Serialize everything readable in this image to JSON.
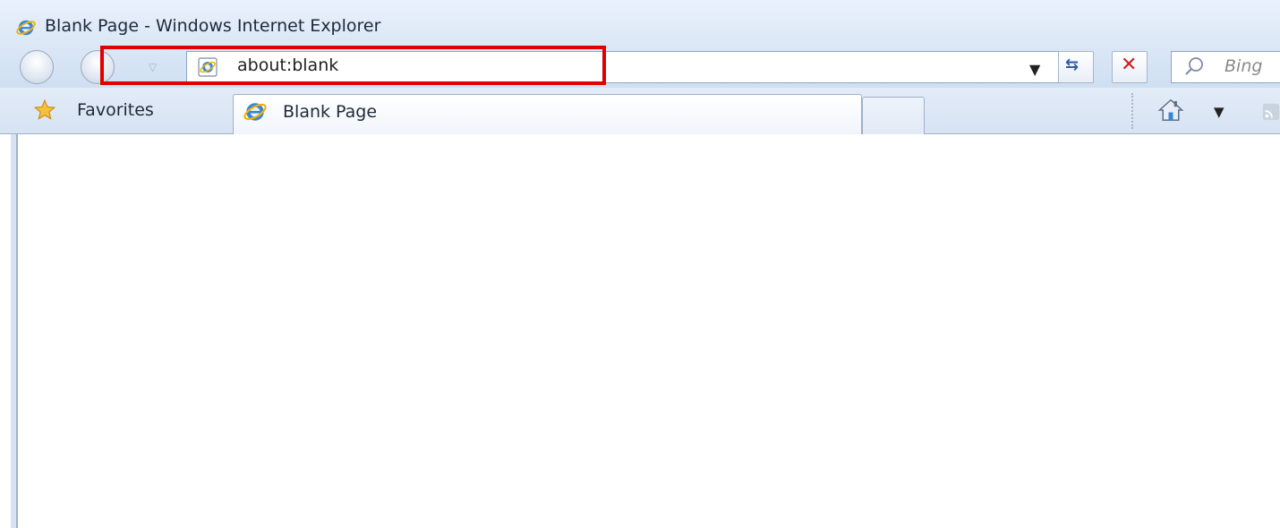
{
  "window": {
    "title": "Blank Page - Windows Internet Explorer"
  },
  "address_bar": {
    "url": "about:blank"
  },
  "search_box": {
    "placeholder": "Bing"
  },
  "favorites_bar": {
    "favorites_label": "Favorites"
  },
  "tabs": [
    {
      "label": "Blank Page"
    }
  ],
  "colors": {
    "highlight": "#e00000",
    "chrome": "#dbe7f6",
    "stop": "#d02020"
  },
  "icons": [
    "ie-logo-icon",
    "back-icon",
    "forward-icon",
    "recent-pages-dropdown-icon",
    "page-icon",
    "address-dropdown-icon",
    "refresh-icon",
    "stop-icon",
    "search-icon",
    "favorites-star-icon",
    "home-icon",
    "feeds-icon"
  ]
}
